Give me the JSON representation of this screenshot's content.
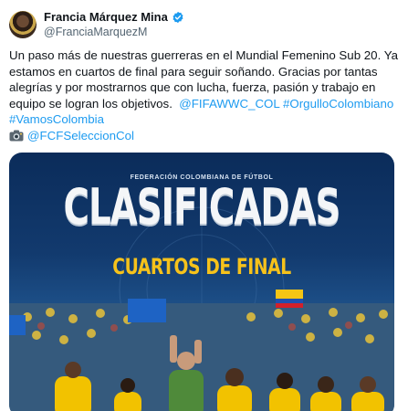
{
  "tweet": {
    "display_name": "Francia Márquez Mina",
    "handle": "@FranciaMarquezM",
    "verified_color": "#1d9bf0",
    "text_lines": [
      "Un paso más de nuestras guerreras en el Mundial Femenino Sub 20. Ya",
      "estamos en cuartos de final para seguir soñando. Gracias por tantas",
      "alegrías y por mostrarnos que con lucha, fuerza, pasión y trabajo en"
    ],
    "line4_text": "equipo se logran los objetivos.",
    "hashtag_fifa": "@FIFAWWC_COL",
    "hashtag_orgullo": "#OrgulloColombiano",
    "hashtag_vamos": "#VamosColombia",
    "photo_credit": "@FCFSeleccionCol",
    "camera_icon": "camera-icon",
    "link_color": "#1d9bf0"
  },
  "media": {
    "federation_text": "FEDERACIÓN COLOMBIANA DE FÚTBOL",
    "headline": "CLASIFICADAS",
    "subheadline": "CUARTOS DE FINAL"
  }
}
